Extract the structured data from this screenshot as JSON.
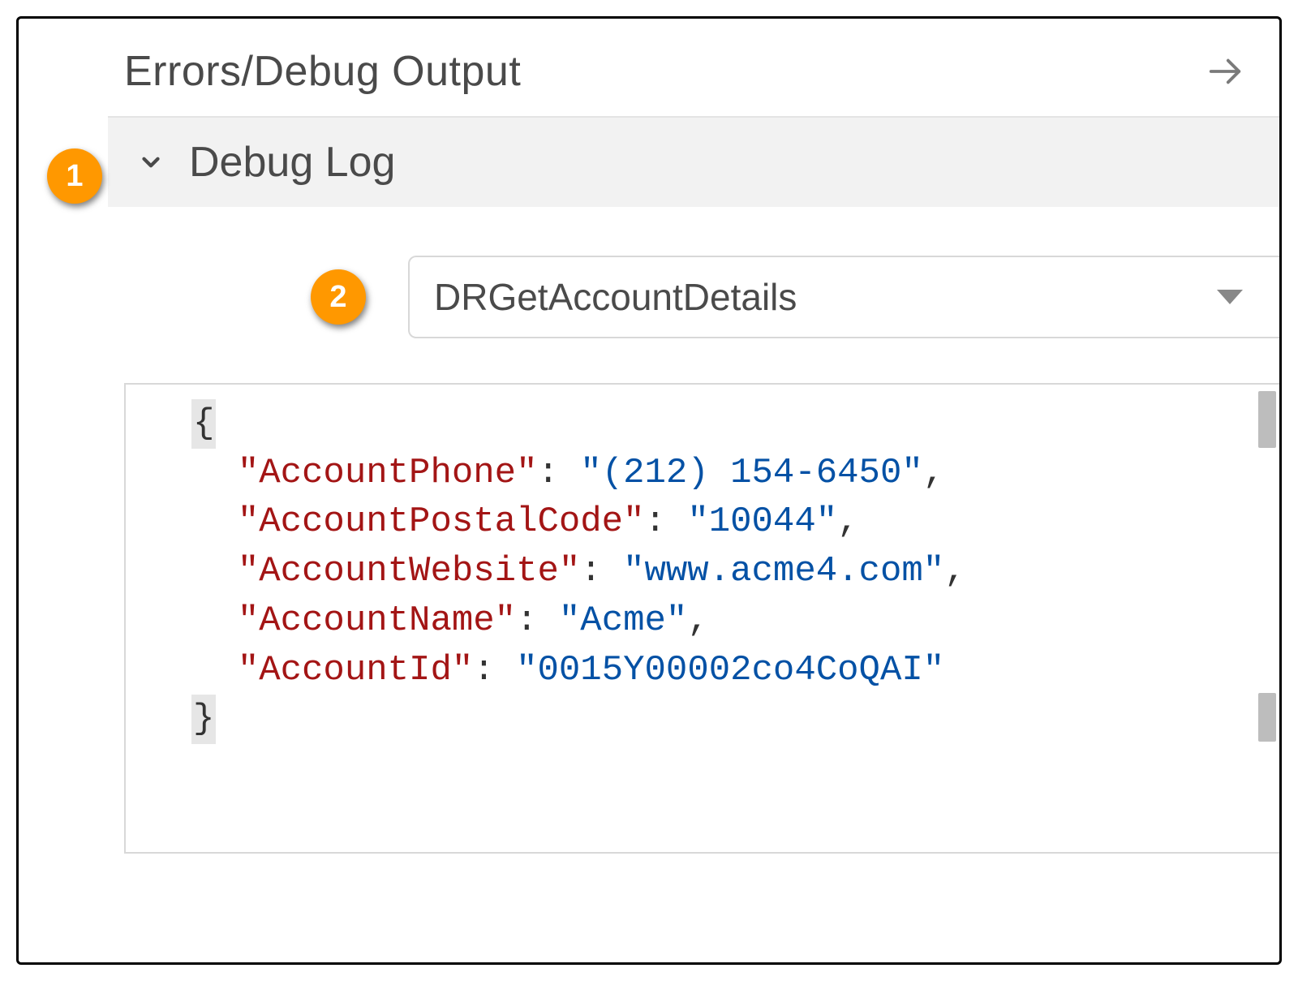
{
  "header": {
    "title": "Errors/Debug Output"
  },
  "callouts": {
    "one": "1",
    "two": "2"
  },
  "section": {
    "title": "Debug Log"
  },
  "dropdown": {
    "selected": "DRGetAccountDetails"
  },
  "json_output": {
    "open_brace": "{",
    "close_brace": "}",
    "entries": [
      {
        "key": "\"AccountPhone\"",
        "value": "\"(212) 154-6450\"",
        "comma": ","
      },
      {
        "key": "\"AccountPostalCode\"",
        "value": "\"10044\"",
        "comma": ","
      },
      {
        "key": "\"AccountWebsite\"",
        "value": "\"www.acme4.com\"",
        "comma": ","
      },
      {
        "key": "\"AccountName\"",
        "value": "\"Acme\"",
        "comma": ","
      },
      {
        "key": "\"AccountId\"",
        "value": "\"0015Y00002co4CoQAI\"",
        "comma": ""
      }
    ]
  }
}
